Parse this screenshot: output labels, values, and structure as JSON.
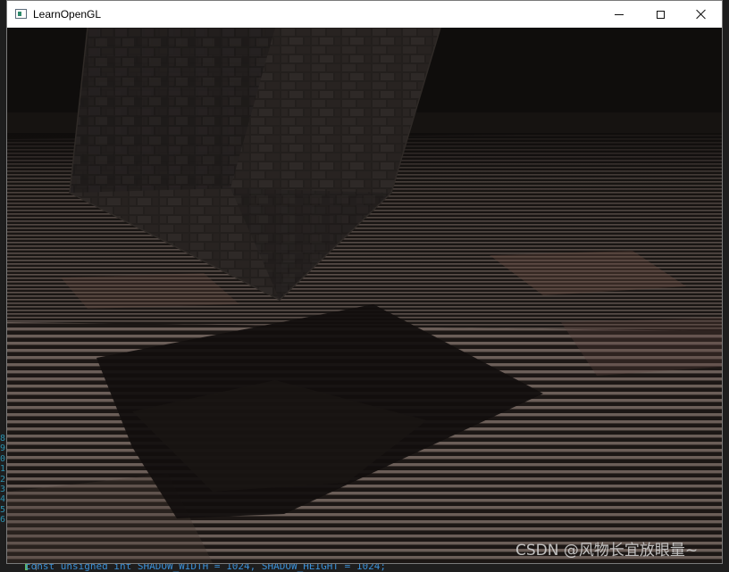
{
  "window": {
    "title": "LearnOpenGL",
    "icon": "opengl-app-icon",
    "controls": {
      "minimize_icon": "minimize-icon",
      "maximize_icon": "maximize-icon",
      "close_icon": "close-icon"
    }
  },
  "scene": {
    "description_icon": "rendered-3d-scene",
    "objects": [
      "textured-cube",
      "checkered-floor",
      "cube-shadow"
    ]
  },
  "background_editor": {
    "line_numbers": [
      "8",
      "9",
      "0",
      "1",
      "2",
      "3",
      "4",
      "5",
      "6"
    ],
    "code_line": "const unsigned int SHADOW_WIDTH = 1024, SHADOW_HEIGHT = 1024;"
  },
  "watermark": "CSDN @风物长宜放眼量~",
  "colors": {
    "titlebar_bg": "#ffffff",
    "code_blue": "#3a8fd6",
    "line_number": "#2b91af"
  }
}
